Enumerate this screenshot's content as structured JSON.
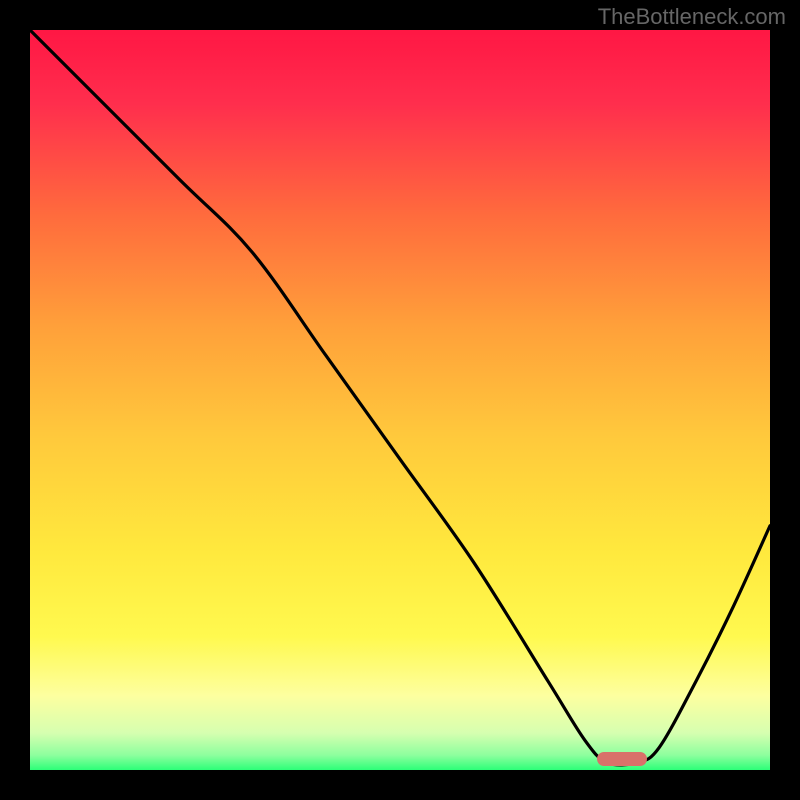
{
  "attribution": "TheBottleneck.com",
  "chart_data": {
    "type": "line",
    "title": "",
    "xlabel": "",
    "ylabel": "",
    "xlim": [
      0,
      100
    ],
    "ylim": [
      0,
      100
    ],
    "series": [
      {
        "name": "curve",
        "x": [
          0,
          5,
          20,
          30,
          40,
          50,
          60,
          70,
          75,
          78,
          82,
          85,
          90,
          95,
          100
        ],
        "values": [
          100,
          95,
          80,
          70,
          56,
          42,
          28,
          12,
          4,
          1,
          1,
          3,
          12,
          22,
          33
        ]
      }
    ],
    "marker": {
      "x": 80,
      "y": 1.5
    }
  }
}
